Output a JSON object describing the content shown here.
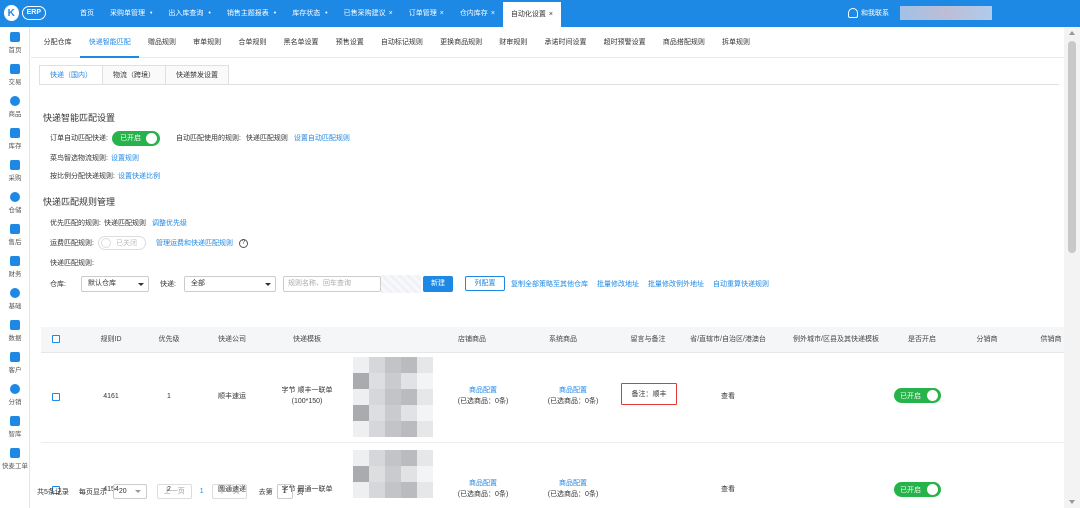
{
  "app": {
    "logo_letter": "K",
    "logo_text": "ERP"
  },
  "top_tabs": [
    {
      "label": "首页",
      "closable": false,
      "dot": false
    },
    {
      "label": "采购单管理",
      "closable": false,
      "dot": true
    },
    {
      "label": "出入库查询",
      "closable": false,
      "dot": true
    },
    {
      "label": "销售主题报表",
      "closable": false,
      "dot": true
    },
    {
      "label": "库存状态",
      "closable": false,
      "dot": true
    },
    {
      "label": "已售采购建议",
      "closable": true,
      "dot": false
    },
    {
      "label": "订单管理",
      "closable": true,
      "dot": false
    },
    {
      "label": "仓内库存",
      "closable": true,
      "dot": false
    },
    {
      "label": "自动化设置",
      "closable": true,
      "dot": false,
      "active": true
    }
  ],
  "header": {
    "contact": "和我联系"
  },
  "left_nav": [
    {
      "label": "首页",
      "icon": "home-icon"
    },
    {
      "label": "交易",
      "icon": "trade-icon"
    },
    {
      "label": "商品",
      "icon": "goods-icon"
    },
    {
      "label": "库存",
      "icon": "stock-icon"
    },
    {
      "label": "采购",
      "icon": "purchase-icon"
    },
    {
      "label": "仓储",
      "icon": "warehouse-icon"
    },
    {
      "label": "售后",
      "icon": "after-sale-icon"
    },
    {
      "label": "财务",
      "icon": "finance-icon"
    },
    {
      "label": "基础",
      "icon": "settings-icon"
    },
    {
      "label": "数据",
      "icon": "data-icon"
    },
    {
      "label": "客户",
      "icon": "customer-icon"
    },
    {
      "label": "分销",
      "icon": "distribution-icon"
    },
    {
      "label": "智库",
      "icon": "library-icon"
    },
    {
      "label": "快麦工单",
      "icon": "ticket-icon"
    }
  ],
  "sub_nav": [
    "分配仓库",
    "快递智能匹配",
    "赠品规则",
    "审单规则",
    "合单规则",
    "黑名单设置",
    "预售设置",
    "自动标记规则",
    "更换商品规则",
    "财审规则",
    "承诺时间设置",
    "超时预警设置",
    "商品搭配规则",
    "拆单规则"
  ],
  "sub_nav_active": 1,
  "inner_tabs": [
    "快递（国内）",
    "物流（跨境）",
    "快递禁发设置"
  ],
  "inner_tabs_active": 0,
  "smart_match": {
    "title": "快递智能匹配设置",
    "auto_label": "订单自动匹配快递:",
    "auto_toggle": "已开启",
    "rule_used_label": "自动匹配使用的规则:",
    "rule_used_value": "快递匹配规则",
    "set_auto_rule": "设置自动匹配规则",
    "cainiao_label": "菜鸟智选物流规则:",
    "cainiao_link": "设置规则",
    "ratio_label": "按比例分配快递规则:",
    "ratio_link": "设置快递比例"
  },
  "rule_mgmt": {
    "title": "快递匹配规则管理",
    "priority_label": "优先匹配的规则:",
    "priority_value": "快递匹配规则",
    "priority_link": "调整优先级",
    "freight_label": "运费匹配规则:",
    "freight_toggle": "已关闭",
    "freight_link": "管理运费和快递匹配规则",
    "help": "?",
    "express_rules_label": "快递匹配规则:"
  },
  "filters": {
    "warehouse_label": "仓库:",
    "warehouse_value": "默认仓库",
    "express_label": "快递:",
    "express_value": "全部",
    "search_placeholder": "规则名称、回车查询",
    "new_button": "新建",
    "column_button": "列配置",
    "actions": [
      "复制全部策略至其他仓库",
      "批量修改地址",
      "批量修改例外地址",
      "自动重算快递规则"
    ]
  },
  "table": {
    "headers": [
      "规则ID",
      "优先级",
      "快递公司",
      "快递模板",
      "店铺商品",
      "系统商品",
      "留言与备注",
      "省/直辖市/自治区/港澳台",
      "例外城市/区县及其快递模板",
      "是否开启",
      "分销商",
      "供销商"
    ],
    "rows": [
      {
        "id": "4161",
        "priority": "1",
        "company": "顺丰速运",
        "template_line1": "字节 顺丰一联单",
        "template_line2": "(100*150)",
        "shop_goods_link": "商品配置",
        "shop_goods_sub": "(已选商品：0条)",
        "sys_goods_link": "商品配置",
        "sys_goods_sub": "(已选商品：0条)",
        "remark": "备注：顺丰",
        "remark_highlighted": true,
        "province_link": "查看",
        "enabled": "已开启"
      },
      {
        "id": "4154",
        "priority": "2",
        "company": "圆通速递",
        "template_line1": "字节 圆通一联单",
        "template_line2": "",
        "shop_goods_link": "商品配置",
        "shop_goods_sub": "(已选商品：0条)",
        "sys_goods_link": "商品配置",
        "sys_goods_sub": "(已选商品：0条)",
        "remark": "",
        "remark_highlighted": false,
        "province_link": "查看",
        "enabled": "已开启"
      }
    ]
  },
  "pagination": {
    "total": "共5条记录",
    "per_page_label": "每页显示",
    "per_page": "20",
    "prev": "上一页",
    "current": "1",
    "next": "下一页",
    "goto_label": "去第",
    "goto_value": "1",
    "page_unit": "页"
  },
  "colors": {
    "primary": "#1e88e5",
    "toggle_on": "#26b34a",
    "highlight": "#e53935"
  }
}
